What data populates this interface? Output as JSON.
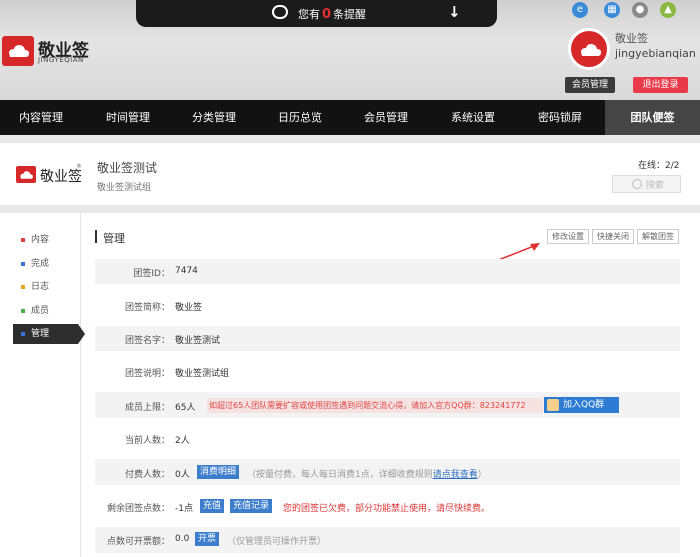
{
  "notice": {
    "prefix": "您有",
    "count": "0",
    "suffix": "条提醒"
  },
  "brand": {
    "name": "敬业签",
    "sub": "JINGYEQIAN"
  },
  "user": {
    "nickname": "敬业签",
    "account": "jingyebianqian",
    "member_btn": "会员管理",
    "logout_btn": "退出登录"
  },
  "nav": [
    "内容管理",
    "时间管理",
    "分类管理",
    "日历总览",
    "会员管理",
    "系统设置",
    "密码锁屏",
    "团队便签"
  ],
  "team": {
    "logo_text": "敬业签",
    "reg": "®",
    "name": "敬业签测试",
    "desc": "敬业签测试组",
    "online_label": "在线：",
    "online_value": "2/2",
    "search_placeholder": "搜索"
  },
  "sidebar": [
    {
      "label": "内容",
      "color": "#e04040"
    },
    {
      "label": "完成",
      "color": "#3b6fd8"
    },
    {
      "label": "日志",
      "color": "#f0a020"
    },
    {
      "label": "成员",
      "color": "#4caf50"
    },
    {
      "label": "管理",
      "color": "#3b6fd8"
    }
  ],
  "section": {
    "title": "管理",
    "btn_edit": "修改设置",
    "btn_close": "快捷关闭",
    "btn_dissolve": "解散团签"
  },
  "fields": {
    "id_label": "团签ID：",
    "id_value": "7474",
    "short_label": "团签简称：",
    "short_value": "敬业签",
    "name_label": "团签名字：",
    "name_value": "敬业签测试",
    "desc_label": "团签说明：",
    "desc_value": "敬业签测试组",
    "limit_label": "成员上限：",
    "limit_value": "65人",
    "limit_note": "如超过65人团队需要扩容或使用团签遇到问题交流心得，请加入官方QQ群：823241772",
    "qq_btn": "加入QQ群",
    "current_label": "当前人数：",
    "current_value": "2人",
    "paid_label": "付费人数：",
    "paid_value": "0人",
    "paid_detail_btn": "消费明细",
    "paid_note_a": "（按量付费，每人每日消费1点，详细收费规则",
    "paid_note_link": "请点我查看",
    "paid_note_b": "）",
    "points_label": "剩余团签点数：",
    "points_value": "-1点",
    "recharge_btn": "充值",
    "recharge_log_btn": "充值记录",
    "points_warn": "您的团签已欠费，部分功能禁止使用，请尽快续费。",
    "invoice_label": "点数可开票额：",
    "invoice_value": "0.0",
    "invoice_btn": "开票",
    "invoice_note": "（仅管理员可操作开票）"
  }
}
